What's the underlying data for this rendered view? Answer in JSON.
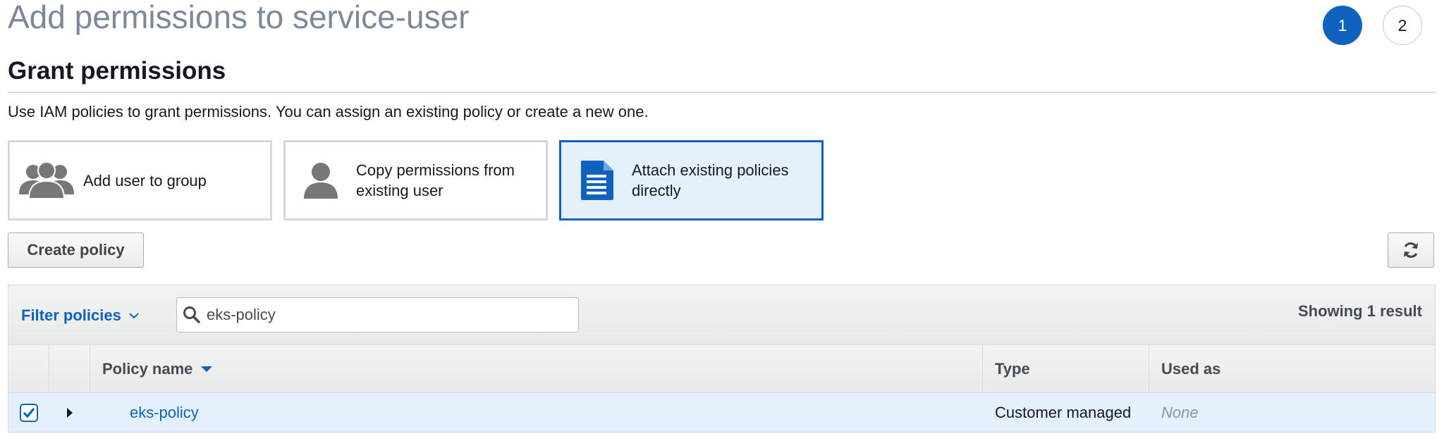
{
  "page": {
    "title": "Add permissions to service-user",
    "steps": [
      "1",
      "2"
    ],
    "active_step": "1"
  },
  "section": {
    "title": "Grant permissions",
    "description": "Use IAM policies to grant permissions. You can assign an existing policy or create a new one."
  },
  "options": [
    {
      "label": "Add user to group",
      "icon": "users-group-icon"
    },
    {
      "label": "Copy permissions from existing user",
      "icon": "user-icon"
    },
    {
      "label": "Attach existing policies directly",
      "icon": "document-icon",
      "selected": true
    }
  ],
  "toolbar": {
    "create_policy_label": "Create policy",
    "refresh_icon": "refresh-icon"
  },
  "filter": {
    "toggle_label": "Filter policies",
    "search_value": "eks-policy",
    "result_text": "Showing 1 result"
  },
  "table": {
    "columns": [
      "Policy name",
      "Type",
      "Used as"
    ],
    "sort_column": "Policy name",
    "rows": [
      {
        "checked": true,
        "name": "eks-policy",
        "type": "Customer managed",
        "used_as": "None"
      }
    ]
  },
  "colors": {
    "accent": "#0f62be",
    "selected_background": "#e4f1fc",
    "title_gray": "#7d8998"
  }
}
